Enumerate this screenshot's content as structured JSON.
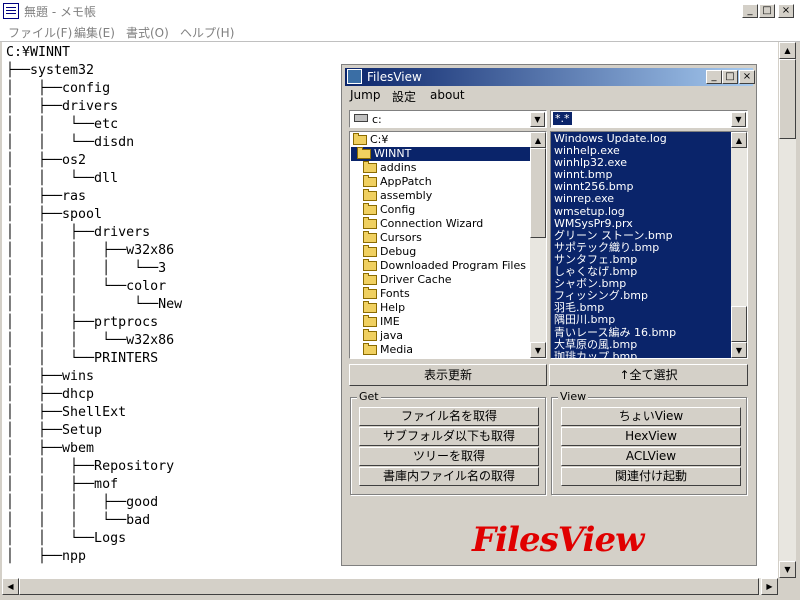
{
  "window": {
    "title": "無題 - メモ帳",
    "min": "_",
    "max": "□",
    "close": "×"
  },
  "menu": [
    "ファイル(F)",
    "編集(E)",
    "書式(O)",
    "ヘルプ(H)"
  ],
  "editor": {
    "lines": [
      "C:¥WINNT",
      "├──system32",
      "│   ├──config",
      "│   ├──drivers",
      "│   │   └──etc",
      "│   │   └──disdn",
      "│   ├──os2",
      "│   │   └──dll",
      "│   ├──ras",
      "│   ├──spool",
      "│   │   ├──drivers",
      "│   │   │   ├──w32x86",
      "│   │   │   │   └──3",
      "│   │   │   └──color",
      "│   │   │       └──New",
      "│   │   ├──prtprocs",
      "│   │   │   └──w32x86",
      "│   │   └──PRINTERS",
      "│   ├──wins",
      "│   ├──dhcp",
      "│   ├──ShellExt",
      "│   ├──Setup",
      "│   ├──wbem",
      "│   │   ├──Repository",
      "│   │   ├──mof",
      "│   │   │   ├──good",
      "│   │   │   └──bad",
      "│   │   └──Logs",
      "│   ├──npp"
    ]
  },
  "filesview": {
    "title": "FilesView",
    "menu": [
      "Jump",
      "設定",
      "about"
    ],
    "drive": "c:",
    "filter": "*.*",
    "dir_root": "C:¥",
    "dir_selected": "WINNT",
    "dirs": [
      "addins",
      "AppPatch",
      "assembly",
      "Config",
      "Connection Wizard",
      "Cursors",
      "Debug",
      "Downloaded Program Files",
      "Driver Cache",
      "Fonts",
      "Help",
      "IME",
      "java",
      "Media"
    ],
    "files": [
      "Windows Update.log",
      "winhelp.exe",
      "winhlp32.exe",
      "winnt.bmp",
      "winnt256.bmp",
      "winrep.exe",
      "wmsetup.log",
      "WMSysPr9.prx",
      "グリーン ストーン.bmp",
      "サポテック織り.bmp",
      "サンタフェ.bmp",
      "しゃくなげ.bmp",
      "シャボン.bmp",
      "フィッシング.bmp",
      "羽毛.bmp",
      "隅田川.bmp",
      "青いレース編み 16.bmp",
      "大草原の風.bmp",
      "珈琲カップ.bmp"
    ],
    "refresh_label": "表示更新",
    "selectall_label": "↑全て選択",
    "get_group": "Get",
    "get_buttons": [
      "ファイル名を取得",
      "サブフォルダ以下も取得",
      "ツリーを取得",
      "書庫内ファイル名の取得"
    ],
    "view_group": "View",
    "view_buttons": [
      "ちょいView",
      "HexView",
      "ACLView",
      "関連付け起動"
    ],
    "logo": "FilesView"
  },
  "colors": {
    "selection": "#0a246a",
    "logo": "#e00000"
  }
}
